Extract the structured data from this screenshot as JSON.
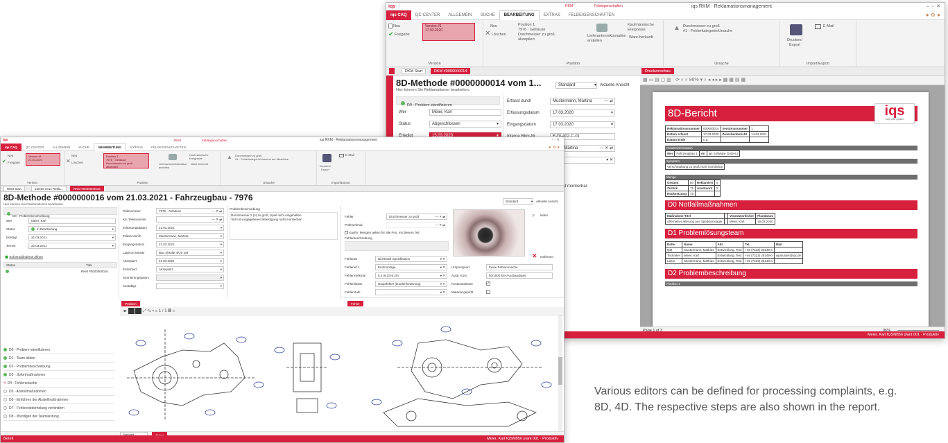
{
  "back_window": {
    "app_title": "iqs RKM - Reklamationsmanagement",
    "small_title_left": "RKM",
    "small_title_right": "Feldeigenschaften",
    "tabs": [
      "iqs CAQ",
      "QC-CENTER",
      "ALLGEMEIN",
      "SUCHE",
      "BEARBEITUNG",
      "EXTRAS",
      "FELDEIGENSCHAFTEN"
    ],
    "ribbon": {
      "new_label": "Neu",
      "release_label": "Freigabe",
      "version_box": "Version #1\n17.03.2020",
      "version_group": "Version",
      "pos_new": "Neu",
      "pos_delete": "Löschen",
      "position_text": "Position 1\n7976 · Gehäuse\nDurchmesser zu groß\nakzeptiert",
      "supplier_sort": "Lieferantenreklamation erstellen",
      "buy_parts": "Kaufmännische Ereignisse",
      "origin": "Ware-herkunft",
      "position_group": "Position",
      "cause_text": "Durchmesser zu groß\n#1 - Fehlerkategorie/Ursache",
      "cause_group": "Ursache",
      "print_export": "Drucken/\nExport",
      "email": "E-Mail",
      "import_export_group": "Import/Export"
    },
    "doctabs": {
      "start": "RKM Start",
      "rkm": "RKM #0000000014",
      "preview": "Druckvorschau"
    },
    "header_title": "8D-Methode #0000000014 vom 1...",
    "header_sub": "Hier können Sie Reklamationen bearbeiten.",
    "view_select": "Standard",
    "current_view": "Aktuelle Ansicht",
    "step_d0": "D0 - Problem identifizieren",
    "fields": [
      {
        "label": "Wer",
        "value": "Meier, Karl"
      },
      {
        "label": "Status",
        "value": "Abgeschlossen"
      },
      {
        "label": "Erledigt",
        "value": "15.03.2020"
      }
    ],
    "right_fields": [
      {
        "label": "Erfasst durch",
        "value": "Mustermann, Martina"
      },
      {
        "label": "Erfassungsdatum",
        "value": "17.03.2020"
      },
      {
        "label": "Eingangsdatum",
        "value": "17.03.2020"
      },
      {
        "label": "Interne Rkm-Nr.",
        "value": "E-DI-402-C-01"
      }
    ],
    "partial_value": "rfass, Martina",
    "partial_value2": "icht montierbar",
    "bottom_partial": "atten",
    "page_indicator": "Page 1 of 3",
    "zoom": "96%",
    "status_text": "Meier, Karl  IQSNB56  plant 001  ·  Produktiv"
  },
  "report": {
    "title": "8D-Bericht",
    "logo": "iqs",
    "logo_sub": "CAQ with system",
    "info_rows": [
      [
        "Reklamationsnummer",
        "000000014",
        "Versionsnummer",
        "1"
      ],
      [
        "Datum erfasst",
        "17.03.2020",
        "Zwischenbericht",
        "14.03.2021"
      ],
      [
        "Datum Ende",
        "n.a.",
        "",
        ""
      ]
    ],
    "sec_kunde": "Kundeninformation",
    "kunde_row": [
      "Wer",
      "Fahrzeugbau 1",
      "An",
      "iqs Software GmbH 2"
    ],
    "sec_symptom": "Symptom",
    "symptom_text": "Verschraubung zu groß nicht montierbar",
    "sec_menge": "Menge",
    "menge_rows": [
      [
        "Gesamt",
        "50",
        "Reklamiert",
        "5"
      ],
      [
        "Zurück",
        "75",
        "Anerkannt",
        "5"
      ],
      [
        "Rücksetzung",
        "75",
        "",
        ""
      ]
    ],
    "d0_title": "D0 Notfallmaßnahmen",
    "d0_header": [
      "Maßnahme-Titel",
      "",
      "Verantwortlicher",
      "Plandatum"
    ],
    "d0_row": [
      "Alternativ-Lieferung aus Speditionslager",
      "",
      "Meier, Karl",
      "16.03.2020"
    ],
    "d1_title": "D1 Problemlösungsteam",
    "d1_header": [
      "Rolle",
      "Name",
      "Abt.",
      "Tel.",
      "Mail"
    ],
    "d1_rows": [
      [
        "QM",
        "Mustermann, Mathias",
        "Entwicklung, Test",
        "+49 (7223) 28149-0",
        ""
      ],
      [
        "Techniker",
        "Meier, Karl",
        "Entwicklung, Test",
        "+49 (7223) 28149-0",
        "wpmuster@iqs.de"
      ],
      [
        "Labor",
        "Mustermann, Mathias",
        "Entwicklung, Test",
        "+49 (7223) 28149-0",
        ""
      ]
    ],
    "d2_title": "D2 Problembeschreibung",
    "d2_sub": "Position 1"
  },
  "front_window": {
    "app_title": "iqs RKM - Reklamationsmanagement",
    "small_title_left": "RKM",
    "small_title_right": "Feldeigenschaften",
    "tabs": [
      "iqs CAQ",
      "QC-CENTER",
      "ALLGEMEIN",
      "SUCHE",
      "BEARBEITUNG",
      "EXTRAS",
      "FELDEIGENSCHAFTEN"
    ],
    "ribbon": {
      "new_label": "Neu",
      "release_label": "Freigabe",
      "version_box": "Version #1\n21.03.2021",
      "version_group": "Version",
      "pos_new": "Neu",
      "pos_delete": "Löschen",
      "position_box": "Position 1\n7976 · Gehäuse\nDurchmesser zu groß\nakzeptiert",
      "supplier_sort": "Lieferantenreklamation erstellen",
      "buy_parts": "Kaufmännische Ereignisse",
      "origin": "Ware-herkunft",
      "position_group": "Position",
      "cause_text": "Durchmesser zu groß\n#1 - Fehlerkategorie/Ursache der Maschine",
      "cause_group": "Ursache",
      "print_export": "Drucken/\nExport",
      "email": "E-Mail",
      "import_export_group": "Import/Export"
    },
    "doctabs": {
      "start": "RKM Start",
      "last": "Zuletzt neue Rekla...",
      "rkm": "RKM #0000000016"
    },
    "header_title": "8D-Methode #0000000016 vom 21.03.2021 - Fahrzeugbau - 7976",
    "header_sub": "Hier können Sie Reklamationen bearbeiten.",
    "view_select": "Standard",
    "current_view": "Aktuelle Ansicht",
    "step_d0": "D0 - Problembeschreibung",
    "left_fields": [
      {
        "label": "Wer",
        "value": "Meier, Karl"
      },
      {
        "label": "Status",
        "value": "In Bearbeitung"
      },
      {
        "label": "Erledigt",
        "value": "21.03.2021"
      },
      {
        "label": "Termin",
        "value": "22.03.2021"
      }
    ],
    "link_measure": "Sofortmaßnahme öffnen",
    "mini_table_head": [
      "Status",
      "Titel"
    ],
    "mini_table_row": "RKM #0000000016",
    "mid_fields": [
      {
        "label": "Teilenummer",
        "value": "7976 · Gehäuse"
      },
      {
        "label": "Kd.-Teilenummer",
        "value": ""
      },
      {
        "label": "Erfassungsdatum",
        "value": "21.03.2021"
      },
      {
        "label": "Erfasst durch",
        "value": "Mustermann, Martina"
      },
      {
        "label": "Eingangsdatum",
        "value": "21.03.2021"
      },
      {
        "label": "Lagerort Muster",
        "value": "Bau 3/Halle 4/Ort 1/B"
      },
      {
        "label": "Akzeptiert",
        "value": "21.03.2021"
      },
      {
        "label": "Entscheid",
        "value": "Akzeptiert"
      },
      {
        "label": "Stornierungsdatum",
        "value": ""
      },
      {
        "label": "Kontaktgr.",
        "value": ""
      }
    ],
    "problem_label": "Problembeschreibung",
    "problem_text": "Durchmesser 2 (4) zu groß, Spiel nicht eingehalten.\nTeil mit vorgegebener Befestigung nicht montierbar!",
    "right_fields": [
      {
        "label": "Fehler",
        "value": "Durchmesser zu groß"
      },
      {
        "label": "Prüfmerkmal",
        "value": ""
      },
      {
        "label": "Fehlerbeschreibung",
        "value": ""
      }
    ],
    "checkbox_text": "Kaufm. Mengen gelten für alle Pos. mit diesem Teil",
    "lower_fields": [
      {
        "label": "Fehlerart",
        "value": "Nichtmaß-Spezifikation"
      },
      {
        "label": "Fehlerort 1",
        "value": "Endmontage"
      },
      {
        "label": "Fehlermerkmal",
        "value": "5.4 (6.0) (6.20)"
      },
      {
        "label": "Fehlerklasse",
        "value": "Hauptfehler (kundenforderung)"
      },
      {
        "label": "Fehlerstufe",
        "value": ""
      }
    ],
    "lower_right_fields": [
      {
        "label": "Ursprungsort",
        "value": "Keine Fehlerursache"
      },
      {
        "label": "Ausb. Kost.",
        "value": "50/1000 Ein-/Ausbaudauer"
      },
      {
        "label": "Kostenauslöser",
        "value": "✓"
      },
      {
        "label": "Material geprüft",
        "value": ""
      }
    ],
    "image_actions": {
      "upload": "laden",
      "delete": "entfernen"
    },
    "problem_tab": "Problem",
    "active_tab": "Fehler",
    "steps": [
      {
        "label": "D0 - Problem identifizieren",
        "state": "done"
      },
      {
        "label": "D1 - Team bilden",
        "state": "done"
      },
      {
        "label": "D2 - Problembeschreibung",
        "state": "done"
      },
      {
        "label": "D3 - Sofortmaßnahmen",
        "state": "done"
      },
      {
        "label": "D4 - Fehlerursache",
        "state": "active"
      },
      {
        "label": "D5 - Abstellmaßnahmen",
        "state": "open"
      },
      {
        "label": "D6 - Einführen der Abstellmaßnahmen",
        "state": "open"
      },
      {
        "label": "D7 - Fehlerwiederholung verhindern",
        "state": "open"
      },
      {
        "label": "D8 - Würdigen der Teamleistung",
        "state": "open"
      }
    ],
    "page_label": "1 / 1",
    "bottom_view": "Standard",
    "bottom_tab": "Ablage",
    "status_left": "Bereit",
    "status_text": "Meier, Karl  IQSNB56  plant 001  ·  Produktiv"
  },
  "caption": "Various editors can be defined for processing complaints, e.g. 8D, 4D. The respective steps are also shown in the report.",
  "colors": {
    "brand_red": "#d6203d",
    "ribbon_gray": "#f3f3f3"
  }
}
